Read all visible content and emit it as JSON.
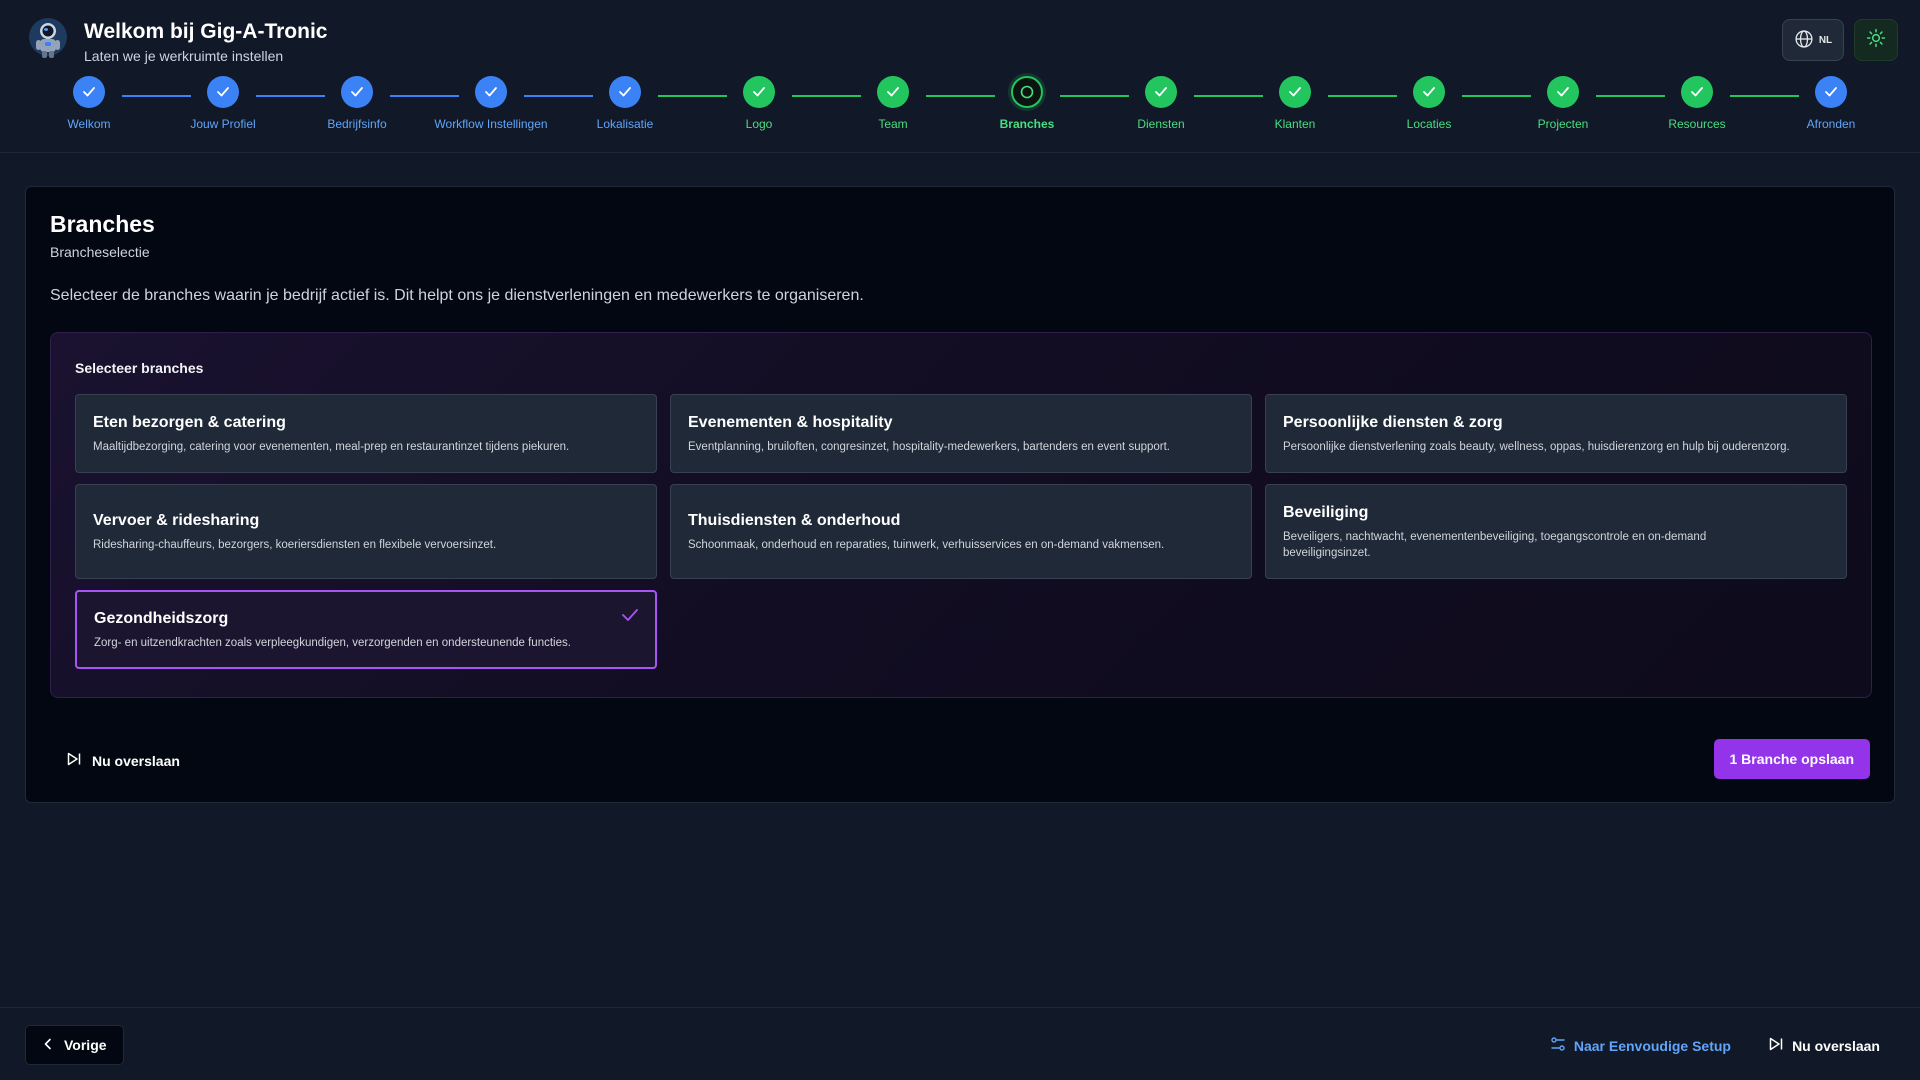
{
  "header": {
    "title": "Welkom bij Gig-A-Tronic",
    "subtitle": "Laten we je werkruimte instellen",
    "lang_label": "NL"
  },
  "colors": {
    "completed_blue": "#3b82f6",
    "completed_green": "#22c55e",
    "accent_purple": "#9333ea",
    "selected_border": "#a855f7"
  },
  "stepper": {
    "steps": [
      {
        "label": "Welkom",
        "status": "done",
        "color": "blue"
      },
      {
        "label": "Jouw Profiel",
        "status": "done",
        "color": "blue"
      },
      {
        "label": "Bedrijfsinfo",
        "status": "done",
        "color": "blue"
      },
      {
        "label": "Workflow Instellingen",
        "status": "done",
        "color": "blue"
      },
      {
        "label": "Lokalisatie",
        "status": "done",
        "color": "blue"
      },
      {
        "label": "Logo",
        "status": "done",
        "color": "green"
      },
      {
        "label": "Team",
        "status": "done",
        "color": "green"
      },
      {
        "label": "Branches",
        "status": "current",
        "color": "green"
      },
      {
        "label": "Diensten",
        "status": "done",
        "color": "green"
      },
      {
        "label": "Klanten",
        "status": "done",
        "color": "green"
      },
      {
        "label": "Locaties",
        "status": "done",
        "color": "green"
      },
      {
        "label": "Projecten",
        "status": "done",
        "color": "green"
      },
      {
        "label": "Resources",
        "status": "done",
        "color": "green"
      },
      {
        "label": "Afronden",
        "status": "done",
        "color": "blue"
      }
    ]
  },
  "main": {
    "title": "Branches",
    "subtitle": "Brancheselectie",
    "description": "Selecteer de branches waarin je bedrijf actief is. Dit helpt ons je dienstverleningen en medewerkers te organiseren.",
    "select_title": "Selecteer branches",
    "options": [
      {
        "title": "Eten bezorgen & catering",
        "desc": "Maaltijdbezorging, catering voor evenementen, meal-prep en restaurantinzet tijdens piekuren.",
        "selected": false
      },
      {
        "title": "Evenementen & hospitality",
        "desc": "Eventplanning, bruiloften, congresinzet, hospitality-medewerkers, bartenders en event support.",
        "selected": false
      },
      {
        "title": "Persoonlijke diensten & zorg",
        "desc": "Persoonlijke dienstverlening zoals beauty, wellness, oppas, huisdierenzorg en hulp bij ouderenzorg.",
        "selected": false
      },
      {
        "title": "Vervoer & ridesharing",
        "desc": "Ridesharing-chauffeurs, bezorgers, koeriersdiensten en flexibele vervoersinzet.",
        "selected": false
      },
      {
        "title": "Thuisdiensten & onderhoud",
        "desc": "Schoonmaak, onderhoud en reparaties, tuinwerk, verhuisservices en on-demand vakmensen.",
        "selected": false
      },
      {
        "title": "Beveiliging",
        "desc": "Beveiligers, nachtwacht, evenementenbeveiliging, toegangscontrole en on-demand beveiligingsinzet.",
        "selected": false
      },
      {
        "title": "Gezondheidszorg",
        "desc": "Zorg- en uitzendkrachten zoals verpleegkundigen, verzorgenden en ondersteunende functies.",
        "selected": true
      }
    ],
    "skip_label": "Nu overslaan",
    "save_label": "1 Branche opslaan"
  },
  "footer": {
    "prev_label": "Vorige",
    "simple_setup_label": "Naar Eenvoudige Setup",
    "skip_label": "Nu overslaan"
  }
}
